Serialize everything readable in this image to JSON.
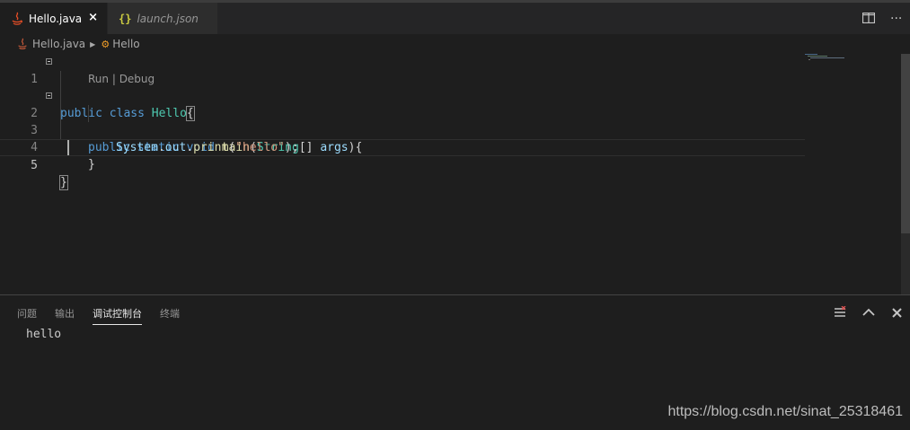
{
  "tabs": [
    {
      "label": "Hello.java",
      "active": true,
      "icon": "java-icon",
      "close": "×"
    },
    {
      "label": "launch.json",
      "active": false,
      "icon": "json-icon",
      "icon_glyph": "{}"
    }
  ],
  "editor_actions": {
    "split_icon": "split-editor-icon",
    "more": "···"
  },
  "breadcrumb": {
    "file": "Hello.java",
    "symbol": "Hello"
  },
  "code": {
    "line_numbers": [
      "1",
      "2",
      "3",
      "4",
      "5"
    ],
    "line1": {
      "kw1": "public",
      "kw2": "class",
      "cls": "Hello",
      "brace": "{"
    },
    "codelens": {
      "run": "Run",
      "sep": " | ",
      "debug": "Debug"
    },
    "line2": {
      "kw1": "public",
      "kw2": "static",
      "kw3": "void",
      "fn": "main",
      "open": "(",
      "type": "String",
      "arr": "[] ",
      "arg": "args",
      "close": "){"
    },
    "line3": {
      "obj": "System",
      "dot1": ".",
      "field": "out",
      "dot2": ".",
      "fn": "print",
      "open": "(",
      "str": "\"hello\"",
      "close": ");"
    },
    "line4": {
      "brace": "}"
    },
    "line5": {
      "brace": "}"
    }
  },
  "panel": {
    "tabs": [
      "问题",
      "输出",
      "调试控制台",
      "终端"
    ],
    "active_tab": "调试控制台",
    "output_text": "hello"
  },
  "watermark": "https://blog.csdn.net/sinat_25318461",
  "colors": {
    "keyword": "#569cd6",
    "type": "#4ec9b0",
    "function": "#dcdcaa",
    "variable": "#9cdcfe",
    "string": "#ce9178",
    "background": "#1e1e1e"
  }
}
